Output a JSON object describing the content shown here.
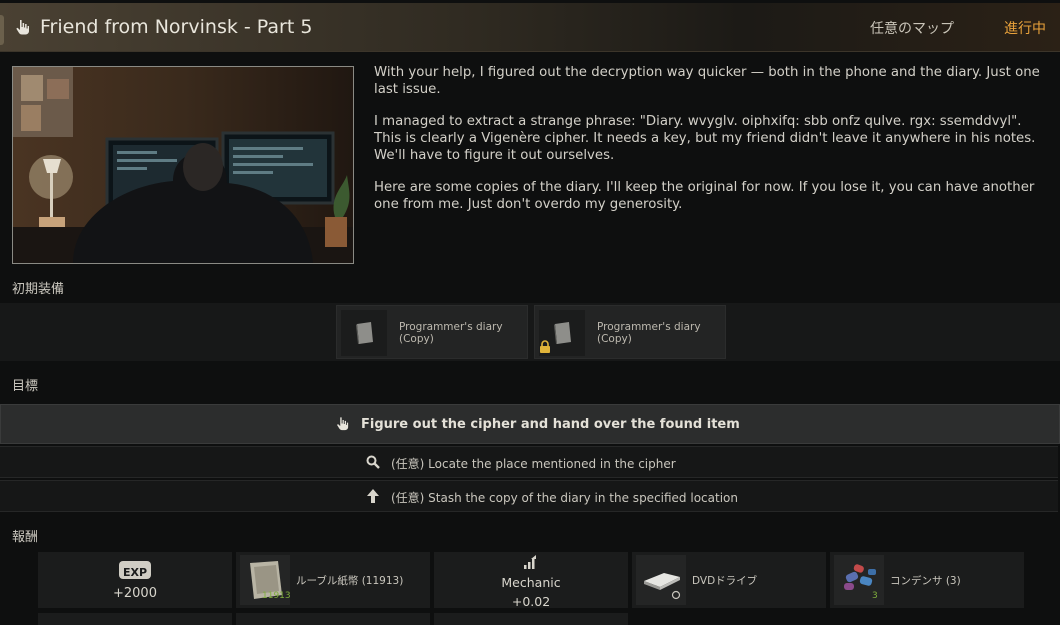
{
  "header": {
    "title": "Friend from Norvinsk - Part 5",
    "map_label": "任意のマップ",
    "status": "進行中"
  },
  "story": {
    "paragraphs": [
      "With your help, I figured out the decryption way quicker — both in the phone and the diary. Just one last issue.",
      "I managed to extract a strange phrase: \"Diary. wvyglv. oiphxifq: sbb onfz qulve. rgx: ssemddvyl\". This is clearly a Vigenère cipher. It needs a key, but my friend didn't leave it anywhere in his notes. We'll have to figure it out ourselves.",
      "Here are some copies of the diary. I'll keep the original for now. If you lose it, you can have another one from me. Just don't overdo my generosity."
    ]
  },
  "sections": {
    "starting_equipment": "初期装備",
    "objectives": "目標",
    "rewards": "報酬"
  },
  "starting_items": [
    {
      "label": "Programmer's diary (Copy)",
      "locked": false
    },
    {
      "label": "Programmer's diary (Copy)",
      "locked": true
    }
  ],
  "objectives": [
    {
      "text": "Figure out the cipher and hand over the found item",
      "icon": "hand-icon",
      "main": true
    },
    {
      "text": "(任意) Locate the place mentioned in the cipher",
      "icon": "search-icon",
      "main": false
    },
    {
      "text": "(任意) Stash the copy of the diary in the specified location",
      "icon": "stash-arrow-icon",
      "main": false
    }
  ],
  "rewards": {
    "exp": {
      "badge": "EXP",
      "value": "+2000"
    },
    "money": {
      "label": "ルーブル紙幣 (11913)",
      "count": "11913"
    },
    "standing": {
      "trader": "Mechanic",
      "value": "+0.02"
    },
    "dvd": {
      "label": "DVDドライブ"
    },
    "capacitor": {
      "label": "コンデンサ (3)",
      "count": "3"
    }
  },
  "colors": {
    "accent_status": "#e9a23b",
    "count_green": "#7fae3c"
  }
}
